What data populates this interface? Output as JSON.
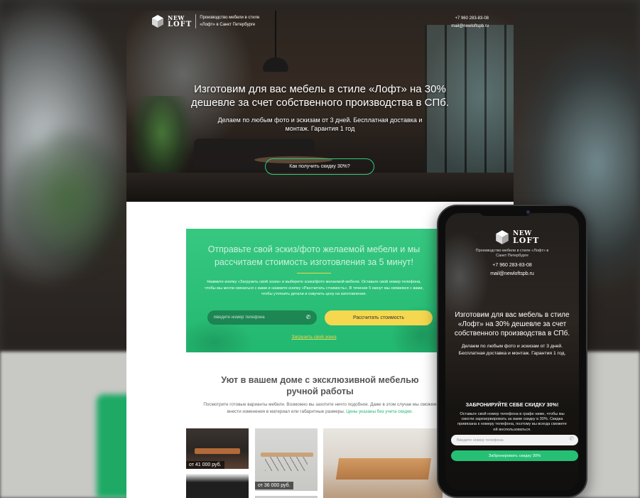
{
  "brand": {
    "logo_line1": "NEW",
    "logo_line2": "LOFT",
    "tagline": "Производство мебели в стиле «Лофт» в Санкт Петербурге"
  },
  "contacts": {
    "phone": "+7 960 283-83-08",
    "email": "mail@newloftspb.ru"
  },
  "hero": {
    "title": "Изготовим для вас мебель в стиле «Лофт» на 30% дешевле за счет собственного производства в СПб.",
    "subtitle": "Делаем по любым фото и эскизам от 3 дней. Бесплатная доставка и монтаж. Гарантия 1 год",
    "cta_label": "Как получить скидку 30%?"
  },
  "sketch_form": {
    "title": "Отправьте свой эскиз/фото желаемой мебели и мы рассчитаем стоимость изготовления за 5 минут!",
    "text": "Нажмите кнопку «Загрузить свой эскиз» и выберите эскиз/фото желаемой мебели. Оставьте свой номер телефона, чтобы мы могли связаться с вами и нажмите кнопку «Рассчитать стоимость». В течение 5 минут мы свяжемся с вами, чтобы уточнить детали и озвучить цену на изготовление.",
    "phone_placeholder": "Введите номер телефона",
    "submit_label": "Рассчитать стоимость",
    "upload_label": "Загрузить свой эскиз"
  },
  "catalog": {
    "title": "Уют в вашем доме с эксклюзивной мебелью ручной работы",
    "text": "Посмотрите готовые варианты мебели. Возможно вы захотите нечто подобное. Даже в этом случае мы сможем внести изменения в материал или габаритные размеры.",
    "text_highlight": "Цены указаны без учета скидки.",
    "items": [
      {
        "price": "от 41 000 руб."
      },
      {
        "price": "от 36 000 руб."
      }
    ]
  },
  "mobile": {
    "logo_line1": "NEW",
    "logo_line2": "LOFT",
    "tagline": "Производство мебели в стиле «Лофт» в Санкт Петербурге",
    "phone": "+7 960 283-83-08",
    "email": "mail@newloftspb.ru",
    "hero_title": "Изготовим для вас мебель в стиле «Лофт» на 30% дешевле за счет собственного производства в СПб.",
    "hero_subtitle": "Делаем по любым фото и эскизам от 3 дней. Бесплатная доставка и монтаж. Гарантия 1 год.",
    "card_title": "ЗАБРОНИРУЙТЕ СЕБЕ СКИДКУ 30%!",
    "card_text": "Оставьте свой номер телефона в графе ниже, чтобы мы смогли зарезервировать за вами скидку в 30%. Скидка привязана к номеру телефона, поэтому вы всегда сможете ей воспользоваться.",
    "phone_placeholder": "Введите номер телефона",
    "submit_label": "Забронировать скидку 30%"
  },
  "colors": {
    "accent_green": "#21b86e",
    "accent_yellow": "#f5d84f"
  }
}
